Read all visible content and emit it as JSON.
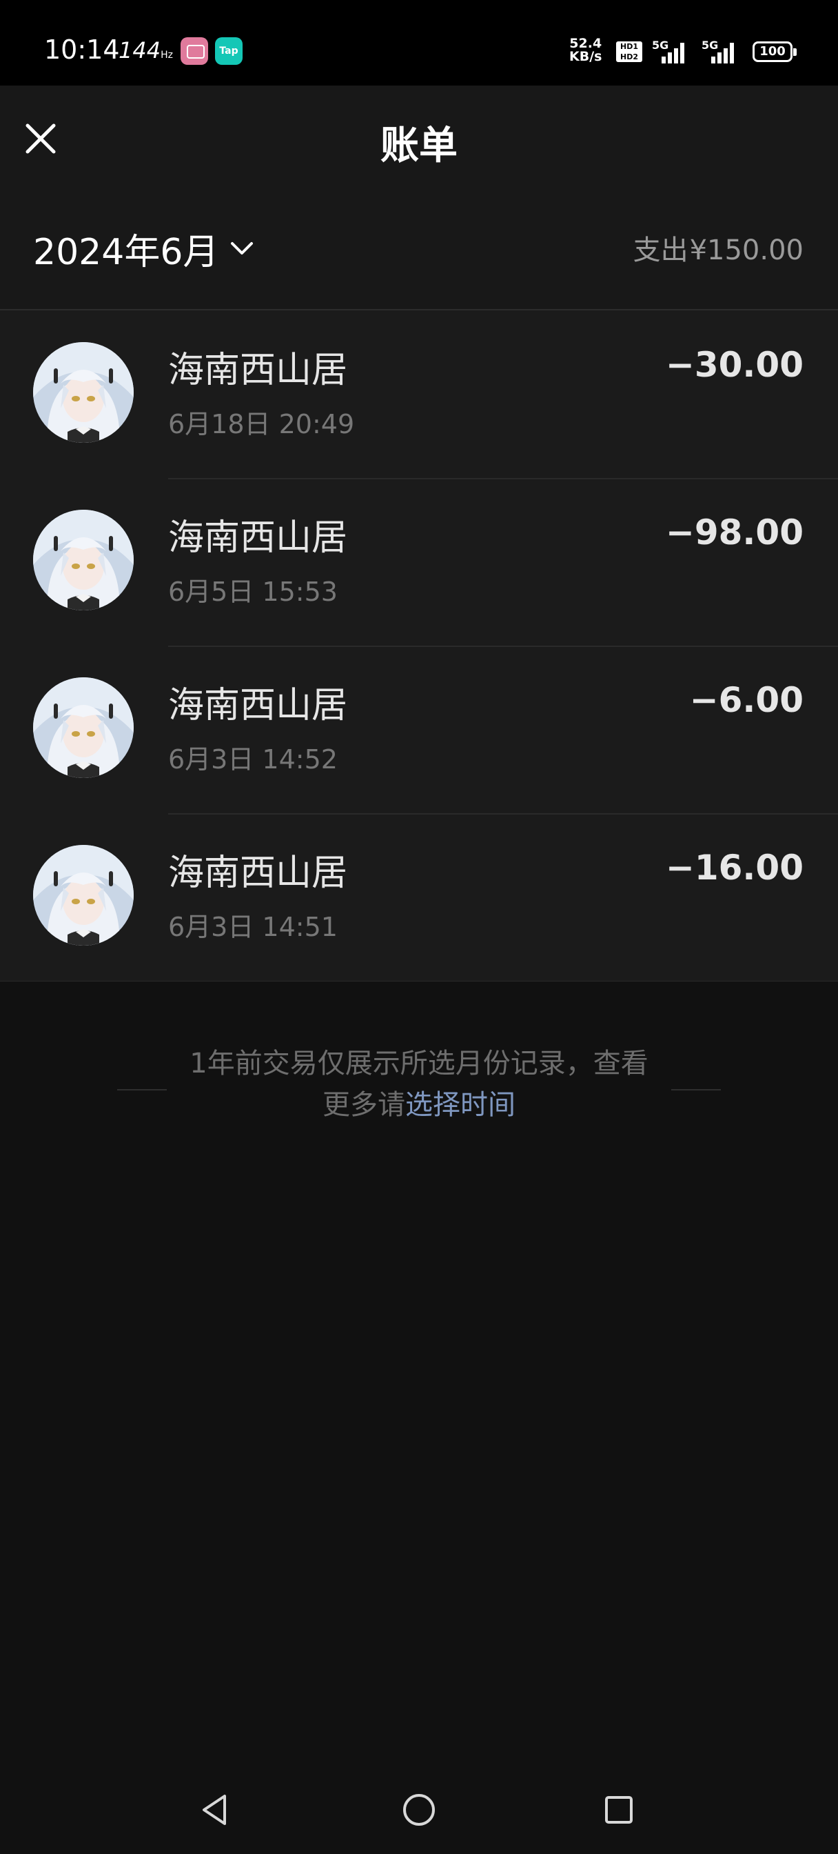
{
  "status_bar": {
    "time": "10:14",
    "refresh_rate": "144",
    "refresh_unit": "Hz",
    "app_icon_2_label": "Tap",
    "net_speed_value": "52.4",
    "net_speed_unit": "KB/s",
    "hd_label_1": "HD1",
    "hd_label_2": "HD2",
    "signal_1_label": "5G",
    "signal_2_label": "5G",
    "battery": "100"
  },
  "header": {
    "title": "账单"
  },
  "month_bar": {
    "month_label": "2024年6月",
    "summary_label": "支出",
    "summary_amount": "¥150.00"
  },
  "transactions": [
    {
      "merchant": "海南西山居",
      "time": "6月18日 20:49",
      "amount": "−30.00"
    },
    {
      "merchant": "海南西山居",
      "time": "6月5日 15:53",
      "amount": "−98.00"
    },
    {
      "merchant": "海南西山居",
      "time": "6月3日 14:52",
      "amount": "−6.00"
    },
    {
      "merchant": "海南西山居",
      "time": "6月3日 14:51",
      "amount": "−16.00"
    }
  ],
  "notice": {
    "text": "1年前交易仅展示所选月份记录，查看更多请",
    "link": "选择时间"
  },
  "icons": {
    "close": "close-icon",
    "month_chevron": "chevron-down-icon",
    "nav_back": "back-triangle-icon",
    "nav_home": "home-circle-icon",
    "nav_recents": "recents-square-icon"
  },
  "colors": {
    "background": "#111111",
    "surface": "#1b1b1b",
    "link": "#7f97c0",
    "muted_text": "#777777"
  }
}
